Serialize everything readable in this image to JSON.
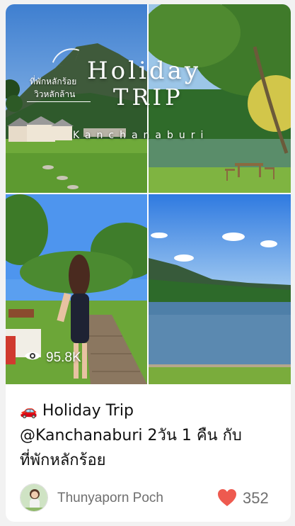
{
  "post": {
    "overlay": {
      "thai_line1": "ที่พักหลักร้อย",
      "thai_line2": "วิวหลักล้าน",
      "title_line1": "Holiday",
      "title_line2": "TRIP",
      "location": "Kanchanaburi"
    },
    "views": "95.8K",
    "caption": {
      "emoji": "🚗",
      "line1": "Holiday Trip",
      "line2": "@Kanchanaburi 2วัน 1 คืน กับ",
      "line3": "ที่พักหลักร้อย"
    },
    "author": "Thunyaporn Poch",
    "likes": "352",
    "colors": {
      "heart": "#ee5a4f",
      "meta_text": "#6f6f6f"
    },
    "icons": [
      "eye-icon",
      "heart-icon",
      "car-emoji"
    ]
  }
}
